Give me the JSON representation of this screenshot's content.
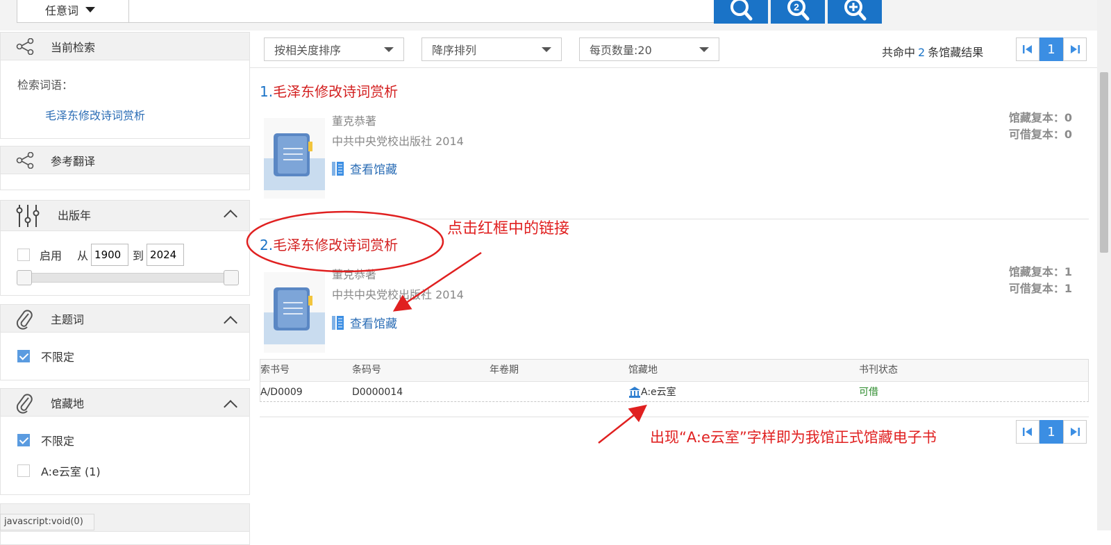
{
  "search": {
    "scope_label": "任意词"
  },
  "sidebar": {
    "current_search": {
      "title": "当前检索",
      "term_label": "检索词语：",
      "term_value": "毛泽东修改诗词赏析"
    },
    "reference_translation": {
      "title": "参考翻译"
    },
    "pub_year": {
      "title": "出版年",
      "enable_label": "启用",
      "from_label": "从",
      "from_value": "1900",
      "to_label": "到",
      "to_value": "2024",
      "slider_range": [
        1900,
        2024
      ]
    },
    "subject": {
      "title": "主题词",
      "unlimited": "不限定"
    },
    "location": {
      "title": "馆藏地",
      "unlimited": "不限定",
      "option1": "A:e云室 (1)"
    }
  },
  "sortbar": {
    "sort_by": "按相关度排序",
    "order": "降序排列",
    "page_size": "每页数量:20",
    "count_prefix": "共命中",
    "count_value": "2",
    "count_suffix": "条馆藏结果",
    "current_page": "1"
  },
  "results": [
    {
      "num": "1.",
      "title": "毛泽东修改诗词赏析",
      "author": "董克恭著",
      "publisher": "中共中央党校出版社 2014",
      "view_label": "查看馆藏",
      "holdings_copies": "馆藏复本：0",
      "lendable_copies": "可借复本：0"
    },
    {
      "num": "2.",
      "title": "毛泽东修改诗词赏析",
      "author": "董克恭著",
      "publisher": "中共中央党校出版社 2014",
      "view_label": "查看馆藏",
      "holdings_copies": "馆藏复本：1",
      "lendable_copies": "可借复本：1"
    }
  ],
  "holdings_table": {
    "headers": [
      "索书号",
      "条码号",
      "年卷期",
      "馆藏地",
      "书刊状态"
    ],
    "row": {
      "call_no": "A/D0009",
      "barcode": "D0000014",
      "volume": "",
      "location": "A:e云室",
      "status": "可借"
    }
  },
  "pagination_bottom": {
    "current_page": "1"
  },
  "annotations": {
    "click_hint": "点击红框中的链接",
    "location_hint": "出现“A:e云室”字样即为我馆正式馆藏电子书"
  },
  "statusbar": {
    "text": "javascript:void(0)"
  },
  "colors": {
    "primary_blue": "#1a73c7",
    "title_red": "#d32020",
    "annotation_red": "#e02020",
    "available_green": "#2a8a2a"
  }
}
